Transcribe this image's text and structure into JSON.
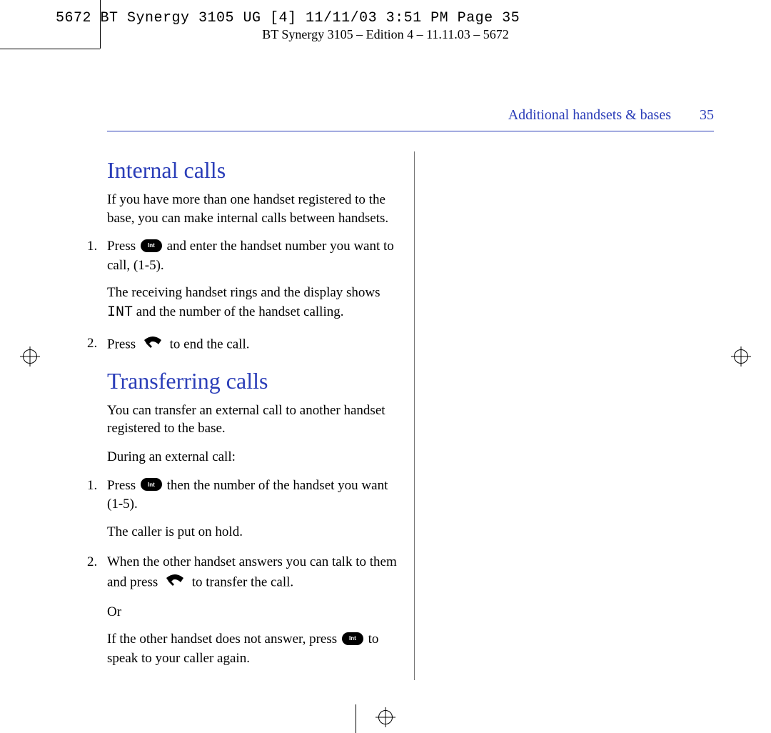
{
  "print_slug": "5672 BT Synergy 3105 UG [4]  11/11/03  3:51 PM  Page 35",
  "edition_line": "BT Synergy 3105 – Edition 4 – 11.11.03 – 5672",
  "running_head": {
    "section": "Additional handsets & bases",
    "page_number": "35"
  },
  "icons": {
    "int_label": "Int"
  },
  "sections": [
    {
      "heading": "Internal calls",
      "intro": "If you have more than one handset registered to the base, you can make internal calls between handsets.",
      "steps": [
        {
          "pre": "Press ",
          "icon": "int",
          "post": " and enter the handset number you want to call, (1-5).",
          "after_a": "The receiving handset rings and the display shows ",
          "after_mono": "INT",
          "after_b": " and the number of the handset calling."
        },
        {
          "pre": "Press ",
          "icon": "hangup",
          "post": " to end the call."
        }
      ]
    },
    {
      "heading": "Transferring calls",
      "intro": "You can transfer an external call to another handset registered to the base.",
      "lead": "During an external call:",
      "steps": [
        {
          "pre": "Press ",
          "icon": "int",
          "post": " then the number of the handset you want (1-5).",
          "after": "The caller is put on hold."
        },
        {
          "pre": "When the other handset answers you can talk to them and press ",
          "icon": "hangup",
          "post": " to transfer the call.",
          "or": "Or",
          "alt_pre": "If the other handset does not answer, press ",
          "alt_icon": "int",
          "alt_post": " to speak to your caller again."
        }
      ]
    }
  ]
}
